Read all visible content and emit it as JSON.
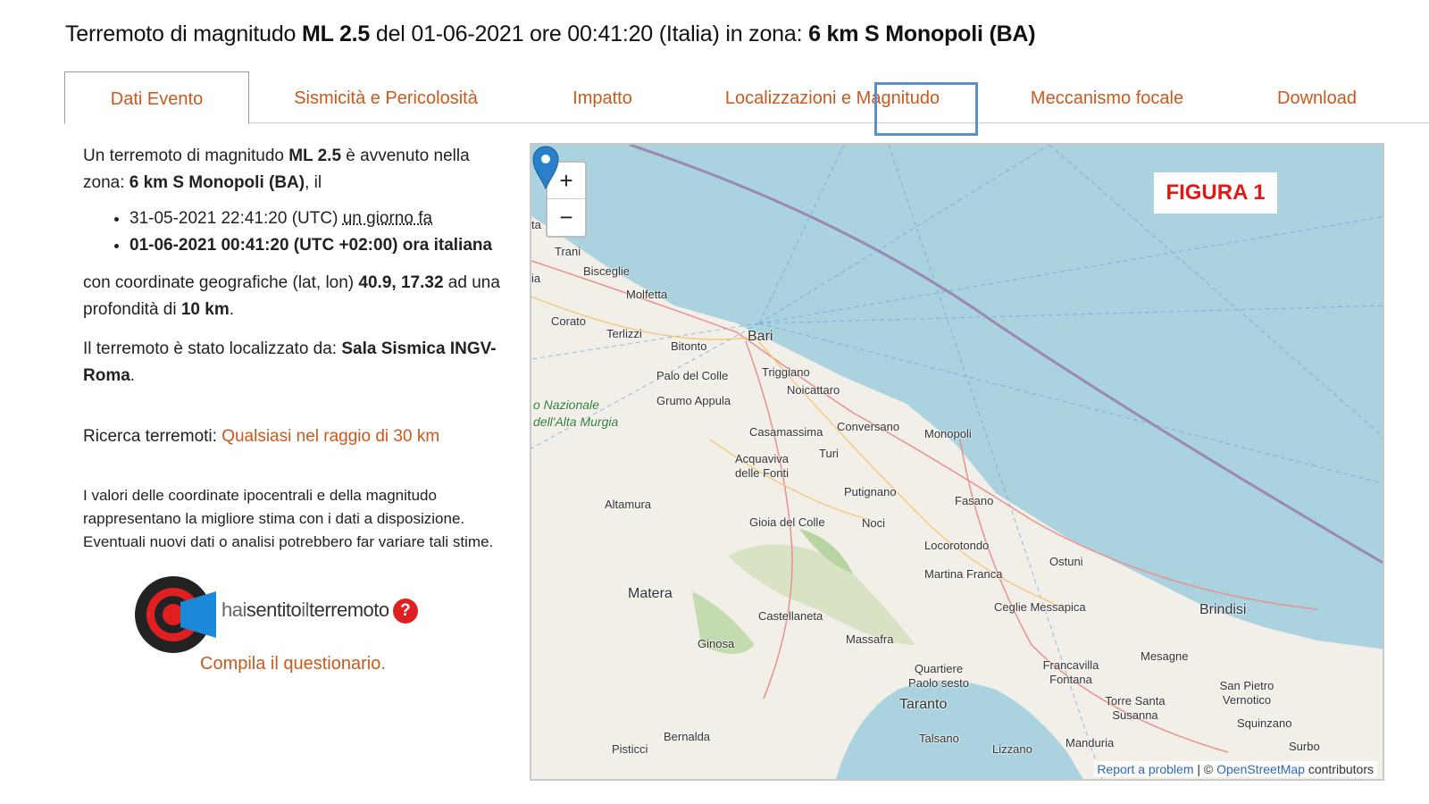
{
  "header": {
    "title_pre": "Terremoto di magnitudo ",
    "title_mag": "ML 2.5",
    "title_mid": " del 01-06-2021 ore 00:41:20 (Italia) in zona: ",
    "title_zone": "6 km S Monopoli (BA)"
  },
  "tabs": [
    {
      "label": "Dati Evento",
      "active": true
    },
    {
      "label": "Sismicità e Pericolosità"
    },
    {
      "label": "Impatto"
    },
    {
      "label": "Localizzazioni e Magnitudo"
    },
    {
      "label": "Meccanismo focale"
    },
    {
      "label": "Download"
    }
  ],
  "event": {
    "intro_a": "Un terremoto di magnitudo ",
    "mag": "ML 2.5",
    "intro_b": " è avvenuto nella zona: ",
    "zone": "6 km S Monopoli (BA)",
    "intro_c": ", il",
    "utc_time": "31-05-2021 22:41:20 (UTC) ",
    "utc_relative": "un giorno fa",
    "local_time": "01-06-2021 00:41:20 (UTC +02:00) ora italiana",
    "coords_a": "con coordinate geografiche (lat, lon) ",
    "coords": "40.9, 17.32",
    "coords_b": " ad una profondità di ",
    "depth": "10 km",
    "coords_c": ".",
    "located_a": "Il terremoto è stato localizzato da: ",
    "located_by": "Sala Sismica INGV-Roma",
    "located_c": ".",
    "search_label": "Ricerca terremoti: ",
    "search_link": "Qualsiasi nel raggio di 30 km",
    "note": "I valori delle coordinate ipocentrali e della magnitudo rappresentano la migliore stima con i dati a disposizione. Eventuali nuovi dati o analisi potrebbero far variare tali stime."
  },
  "haisentito": {
    "hai": "hai",
    "sentito": "sentito",
    "il": "il",
    "terremoto": "terremoto",
    "qmark": "?",
    "link": "Compila il questionario."
  },
  "map": {
    "zoom_in": "+",
    "zoom_out": "−",
    "figure_label": "FIGURA 1",
    "report": "Report a problem",
    "attribution_sep": " | © ",
    "osm": "OpenStreetMap",
    "contributors": " contributors",
    "cities": [
      "Trani",
      "Bisceglie",
      "Molfetta",
      "Corato",
      "Terlizzi",
      "Bitonto",
      "Bari",
      "Triggiano",
      "Palo del Colle",
      "Noicattaro",
      "Grumo Appula",
      "Casamassima",
      "Conversano",
      "Monopoli",
      "Acquaviva delle Fonti",
      "Turi",
      "Putignano",
      "Fasano",
      "Altamura",
      "Gioia del Colle",
      "Noci",
      "Locorotondo",
      "Ostuni",
      "Martina Franca",
      "Matera",
      "Ceglie Messapica",
      "Brindisi",
      "Castellaneta",
      "Massafra",
      "Ginosa",
      "Mesagne",
      "Francavilla Fontana",
      "Quartiere Paolo sesto",
      "Taranto",
      "San Pietro Vernotico",
      "Torre Santa Susanna",
      "Squinzano",
      "Bernalda",
      "Talsano",
      "Lizzano",
      "Manduria",
      "Surbo",
      "Pisticci",
      "ta",
      "ia"
    ],
    "park": "o Nazionale dell'Alta Murgia",
    "colors": {
      "sea": "#aad3df",
      "land": "#f2efe9",
      "forest": "#b8d4a0",
      "accent": "#c85a1e",
      "pin": "#2a7fc9"
    }
  }
}
